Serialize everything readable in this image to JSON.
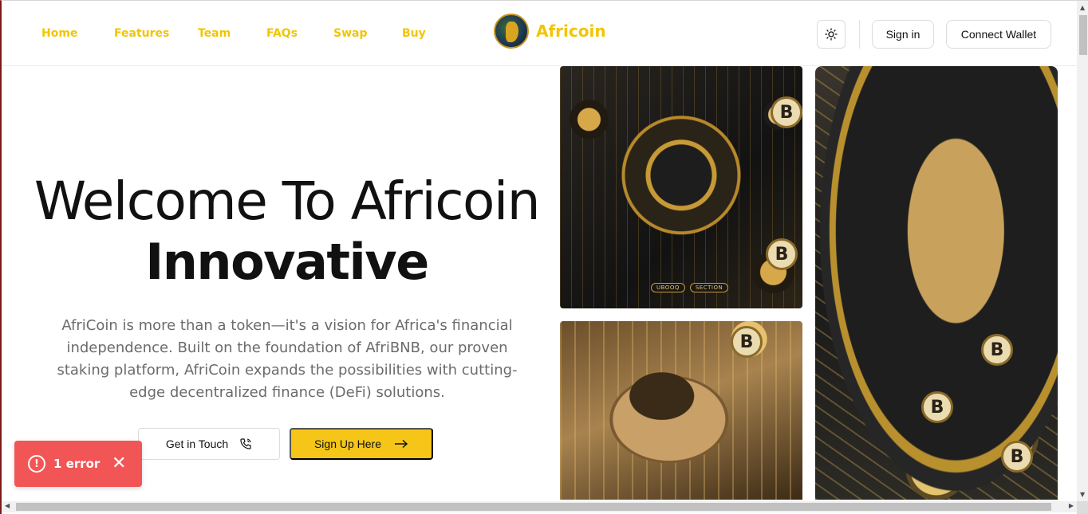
{
  "nav": {
    "items": [
      {
        "label": "Home"
      },
      {
        "label": "Features"
      },
      {
        "label": "Team"
      },
      {
        "label": "FAQs"
      },
      {
        "label": "Swap"
      },
      {
        "label": "Buy"
      }
    ]
  },
  "brand": {
    "name": "Africoin"
  },
  "header": {
    "theme_icon": "sun-icon",
    "signin_label": "Sign in",
    "connect_label": "Connect Wallet"
  },
  "hero": {
    "title_line1": "Welcome To Africoin",
    "title_line2": "Innovative",
    "description": "AfriCoin is more than a token—it's a vision for Africa's financial independence. Built on the foundation of AfriBNB, our proven staking platform, AfriCoin expands the possibilities with cutting-edge decentralized finance (DeFi) solutions.",
    "touch_label": "Get in Touch",
    "touch_icon": "phone-icon",
    "signup_label": "Sign Up Here",
    "signup_icon": "arrow-right-icon"
  },
  "gallery": {
    "image1_tags": [
      "UBOOQ",
      "SECTION"
    ],
    "coin_glyph": "B"
  },
  "toast": {
    "icon": "alert-circle-icon",
    "text": "1 error",
    "close_icon": "close-icon",
    "color": "#f25555"
  },
  "theme": {
    "accent": "#f5c518",
    "brand_text": "#f2c500"
  }
}
